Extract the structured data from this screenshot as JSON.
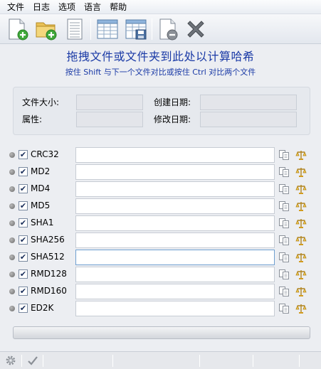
{
  "menu": [
    "文件",
    "日志",
    "选项",
    "语言",
    "帮助"
  ],
  "toolbar": {
    "icons": [
      "new-file-icon",
      "open-folder-icon",
      "document-icon",
      "table-icon",
      "table-save-icon",
      "remove-doc-icon",
      "close-icon"
    ]
  },
  "hint": {
    "title": "拖拽文件或文件夹到此处以计算哈希",
    "subtitle": "按住 Shift 与下一个文件对比或按住 Ctrl 对比两个文件"
  },
  "info": {
    "file_size_label": "文件大小:",
    "attributes_label": "属性:",
    "created_label": "创建日期:",
    "modified_label": "修改日期:"
  },
  "hashes": [
    {
      "name": "CRC32",
      "checked": true,
      "value": ""
    },
    {
      "name": "MD2",
      "checked": true,
      "value": ""
    },
    {
      "name": "MD4",
      "checked": true,
      "value": ""
    },
    {
      "name": "MD5",
      "checked": true,
      "value": ""
    },
    {
      "name": "SHA1",
      "checked": true,
      "value": ""
    },
    {
      "name": "SHA256",
      "checked": true,
      "value": ""
    },
    {
      "name": "SHA512",
      "checked": true,
      "value": ""
    },
    {
      "name": "RMD128",
      "checked": true,
      "value": ""
    },
    {
      "name": "RMD160",
      "checked": true,
      "value": ""
    },
    {
      "name": "ED2K",
      "checked": true,
      "value": ""
    }
  ],
  "colors": {
    "accent_text": "#1a3aa6",
    "focus_border": "#6f9fd0"
  }
}
